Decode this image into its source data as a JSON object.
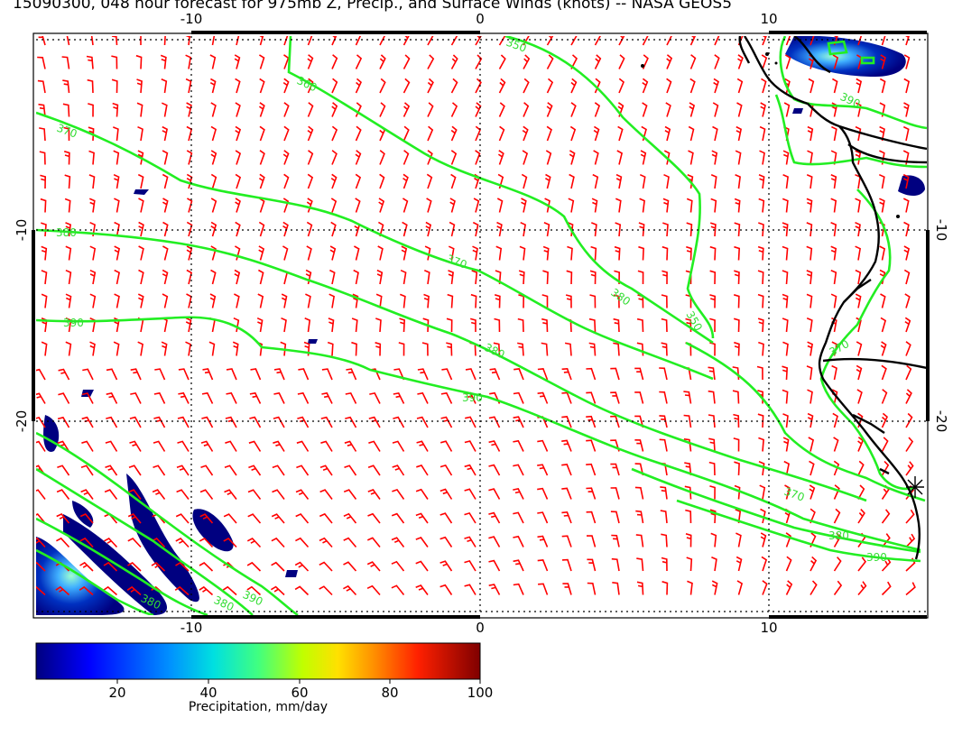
{
  "title": "15090300, 048 hour forecast for 975mb Z, Precip., and Surface Winds (knots) -- NASA GEOS5",
  "chart_data": {
    "type": "map",
    "lon_ticks": [
      "-10",
      "0",
      "10"
    ],
    "lat_ticks": [
      "-10",
      "-20"
    ],
    "top_lon_ticks": [
      "-10",
      "0",
      "10"
    ],
    "contour_labels": [
      "350",
      "360",
      "370",
      "380",
      "390",
      "370",
      "380",
      "380",
      "390",
      "350",
      "370",
      "380",
      "390",
      "380",
      "390",
      "380",
      "390",
      "370"
    ],
    "contour_levels": [
      350,
      360,
      370,
      380,
      390
    ],
    "colorbar": {
      "label": "Precipitation, mm/day",
      "ticks": [
        "20",
        "40",
        "60",
        "80",
        "100"
      ],
      "min": 0,
      "max": 100
    },
    "grid": true,
    "colors": {
      "contour": "#22ee22",
      "wind_barb": "#ff0000",
      "coastline": "#000000",
      "precip_low": "#000080",
      "precip_high": "#800000"
    }
  }
}
